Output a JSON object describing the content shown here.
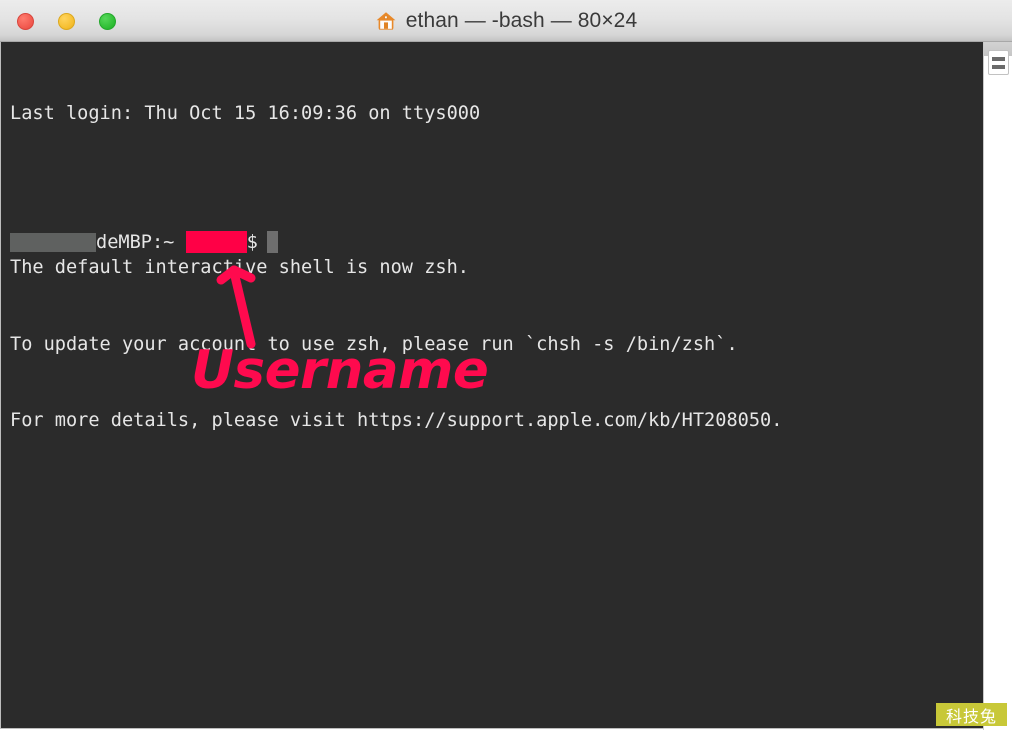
{
  "window": {
    "title": "ethan — -bash — 80×24",
    "home_icon": "home-icon",
    "controls": {
      "close": "close",
      "minimize": "minimize",
      "maximize": "maximize"
    }
  },
  "terminal": {
    "background_color": "#2b2b2b",
    "text_color": "#e6e6e6",
    "lines": [
      "Last login: Thu Oct 15 16:09:36 on ttys000",
      "",
      "The default interactive shell is now zsh.",
      "To update your account to use zsh, please run `chsh -s /bin/zsh`.",
      "For more details, please visit https://support.apple.com/kb/HT208050."
    ],
    "prompt": {
      "redacted_host_block": "",
      "host_suffix": "deMBP:~ ",
      "redacted_user_block": "",
      "symbol": "$",
      "cursor": "",
      "redact_gray_color": "#5f6160",
      "redact_pink_color": "#ff0046",
      "cursor_color": "#6e6e6e"
    }
  },
  "annotation": {
    "label": "Username",
    "color": "#ff0a4e",
    "arrow": "up-arrow"
  },
  "scrollbar": {
    "thumb": "scroll-thumb"
  },
  "watermark": {
    "text": "科技兔",
    "background_color": "#c8c838"
  }
}
